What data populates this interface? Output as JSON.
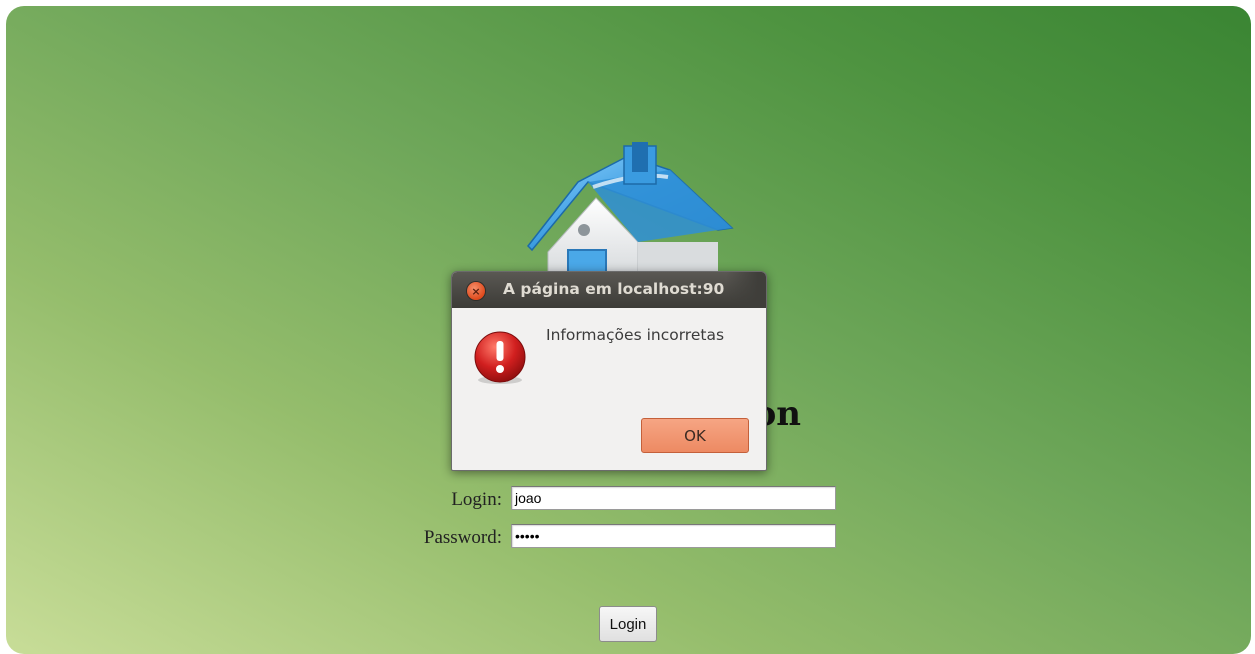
{
  "page": {
    "heading_visible_fragment": "on"
  },
  "form": {
    "login_label": "Login:",
    "login_value": "joao",
    "password_label": "Password:",
    "password_value": "•••••",
    "submit_label": "Login"
  },
  "dialog": {
    "title": "A página em localhost:90",
    "message": "Informações incorretas",
    "ok_label": "OK",
    "close_glyph": "×",
    "icon": "error-exclamation-icon"
  },
  "colors": {
    "background_light": "#c8dd98",
    "background_dark": "#3a8533",
    "dialog_titlebar": "#3c3b37",
    "ok_button": "#ed8a63",
    "close_button": "#df4a1c",
    "error_icon": "#c4161c",
    "house_roof": "#3a9be0"
  }
}
